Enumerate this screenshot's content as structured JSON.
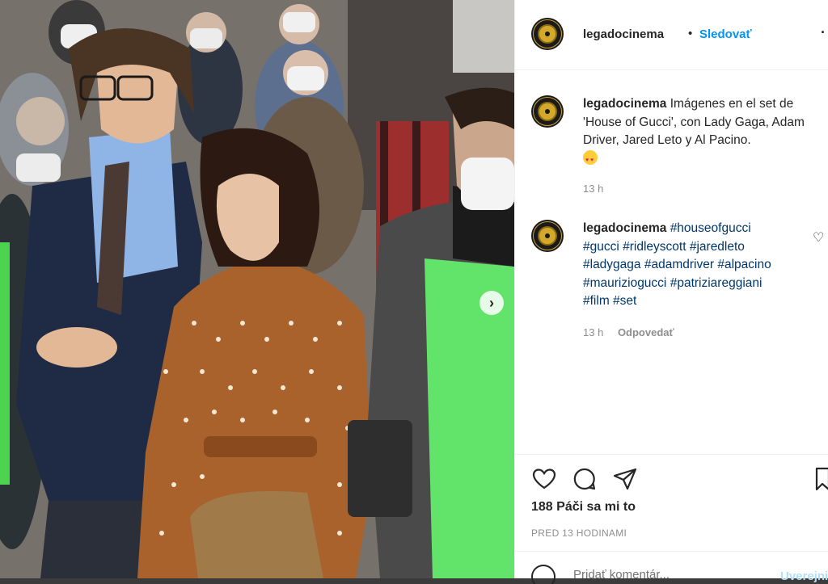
{
  "header": {
    "username": "legadocinema",
    "dot": "•",
    "follow_label": "Sledovať",
    "more_icon": "more-icon"
  },
  "caption": {
    "username": "legadocinema",
    "text": "Imágenes en el set de 'House of Gucci', con Lady Gaga, Adam Driver, Jared Leto y Al Pacino.",
    "emoji": "heart-eyes-emoji",
    "time": "13 h"
  },
  "comment": {
    "username": "legadocinema",
    "hashtags": [
      "#houseofgucci",
      "#gucci",
      "#ridleyscott",
      "#jaredleto",
      "#ladygaga",
      "#adamdriver",
      "#alpacino",
      "#mauriziogucci",
      "#patriziareggiani",
      "#film",
      "#set"
    ],
    "time": "13 h",
    "reply_label": "Odpovedať"
  },
  "actions": {
    "likes": "188 Páči sa mi to",
    "time_ago": "PRED 13 HODINAMI"
  },
  "add_comment": {
    "placeholder": "Pridať komentár...",
    "post_label": "Uverejniť"
  },
  "colors": {
    "accent": "#0095f6",
    "hashtag": "#00376b",
    "muted": "#8e8e8e",
    "text": "#262626"
  }
}
